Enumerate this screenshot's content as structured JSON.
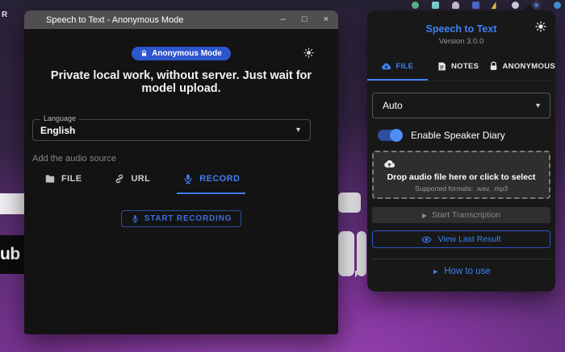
{
  "desktop": {
    "background_top_color": "#2a2138",
    "background_accent_color": "#8637a0",
    "partial_text_r": "R",
    "partial_text_ub": "ub"
  },
  "browser_toolbar": {
    "icons": [
      "extension-green",
      "extension-teal",
      "extension-gray",
      "extension-blue",
      "extension-bolt",
      "extension-light",
      "extension-active",
      "extension-blue-circle"
    ]
  },
  "main_window": {
    "title": "Speech to Text - Anonymous Mode",
    "controls": {
      "minimize": "–",
      "maximize": "□",
      "close": "×"
    },
    "badge_label": "Anonymous Mode",
    "headline": "Private local work, without server. Just wait for model upload.",
    "language_label": "Language",
    "language_value": "English",
    "caret": "▾",
    "source_hint": "Add the audio source",
    "tabs": [
      {
        "label": "FILE",
        "active": false
      },
      {
        "label": "URL",
        "active": false
      },
      {
        "label": "RECORD",
        "active": true
      }
    ],
    "record_button_label": "START RECORDING"
  },
  "side_panel": {
    "title": "Speech to Text",
    "version": "Version 3.0.0",
    "tabs": [
      {
        "label": "FILE",
        "active": true
      },
      {
        "label": "NOTES",
        "active": false
      },
      {
        "label": "ANONYMOUS",
        "active": false
      }
    ],
    "model_value": "Auto",
    "caret": "▾",
    "toggle_label": "Enable Speaker Diary",
    "toggle_state": "on",
    "dropzone_title": "Drop audio file here or click to select",
    "dropzone_subtitle": "Supported formats: .wav, .mp3",
    "start_button_label": "Start Transcription",
    "view_button_label": "View Last Result",
    "help_label": "How to use",
    "play_glyph": "▶",
    "arrow_glyph": "►"
  },
  "colors": {
    "accent_blue": "#3f7df0",
    "panel_accent_blue": "#3b82f6",
    "badge_blue": "#2d55cc",
    "window_bg": "#131313",
    "panel_bg": "#181818",
    "titlebar_bg": "#4f4e50",
    "dropzone_bg": "#2e2e2e"
  }
}
